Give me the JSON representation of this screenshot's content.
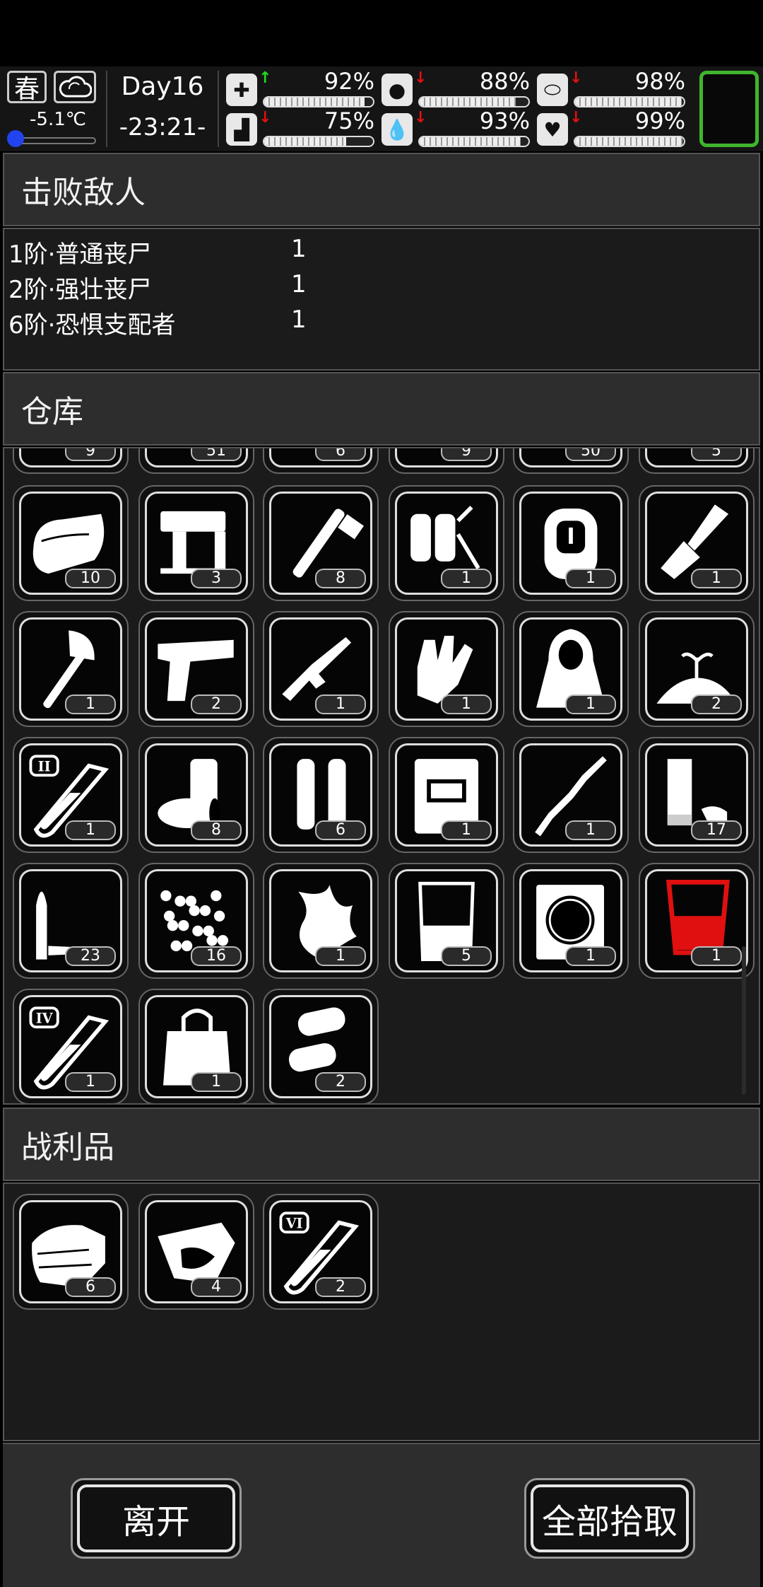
{
  "status": {
    "season": "春",
    "weather_icon": "cloud-icon",
    "temperature": "-5.1℃",
    "day": "Day16",
    "clock": "-23:21-",
    "stats": [
      {
        "key": "health",
        "icon": "medkit-icon",
        "trend": "up",
        "value": "92%",
        "level": 0.92
      },
      {
        "key": "hunger",
        "icon": "stomach-icon",
        "trend": "down",
        "value": "88%",
        "level": 0.88
      },
      {
        "key": "medicine",
        "icon": "pill-icon",
        "trend": "down",
        "value": "98%",
        "level": 0.98
      },
      {
        "key": "stamina",
        "icon": "boot-icon",
        "trend": "down",
        "value": "75%",
        "level": 0.75
      },
      {
        "key": "thirst",
        "icon": "water-drop-icon",
        "trend": "down",
        "value": "93%",
        "level": 0.93
      },
      {
        "key": "mood",
        "icon": "heart-icon",
        "trend": "down",
        "value": "99%",
        "level": 0.99
      }
    ]
  },
  "defeated": {
    "title": "击败敌人",
    "enemies": [
      {
        "name": "1阶·普通丧尸",
        "count": "1"
      },
      {
        "name": "2阶·强壮丧尸",
        "count": "1"
      },
      {
        "name": "6阶·恐惧支配者",
        "count": "1"
      }
    ]
  },
  "storage": {
    "title": "仓库",
    "partial_row": [
      "9",
      "51",
      "6",
      "9",
      "50",
      "5"
    ],
    "items": [
      {
        "icon": "cloth-icon",
        "count": "10"
      },
      {
        "icon": "nail-gun-icon",
        "count": "3"
      },
      {
        "icon": "pipe-wrench-icon",
        "count": "8"
      },
      {
        "icon": "scuba-tanks-icon",
        "count": "1"
      },
      {
        "icon": "backpack-icon",
        "count": "1"
      },
      {
        "icon": "shovel-icon",
        "count": "1"
      },
      {
        "icon": "axe-icon",
        "count": "1"
      },
      {
        "icon": "pistol-icon",
        "count": "2"
      },
      {
        "icon": "submachine-gun-icon",
        "count": "1"
      },
      {
        "icon": "glove-icon",
        "count": "1"
      },
      {
        "icon": "cloak-icon",
        "count": "1"
      },
      {
        "icon": "soil-sprout-icon",
        "count": "2"
      },
      {
        "icon": "test-tube-ii-icon",
        "count": "1",
        "label": "II"
      },
      {
        "icon": "cans-icon",
        "count": "8"
      },
      {
        "icon": "rifle-ammo-icon",
        "count": "6"
      },
      {
        "icon": "battery-blueprint-icon",
        "count": "1"
      },
      {
        "icon": "stick-icon",
        "count": "1"
      },
      {
        "icon": "shotgun-shell-icon",
        "count": "17"
      },
      {
        "icon": "bullet-icon",
        "count": "23"
      },
      {
        "icon": "seeds-icon",
        "count": "16"
      },
      {
        "icon": "herb-icon",
        "count": "1"
      },
      {
        "icon": "beaker-icon",
        "count": "5"
      },
      {
        "icon": "wheel-blueprint-icon",
        "count": "1"
      },
      {
        "icon": "red-liquid-glass-icon",
        "count": "1"
      },
      {
        "icon": "test-tube-iv-icon",
        "count": "1",
        "label": "IV"
      },
      {
        "icon": "bag-icon",
        "count": "1"
      },
      {
        "icon": "pistol-ammo-icon",
        "count": "2"
      }
    ]
  },
  "loot": {
    "title": "战利品",
    "items": [
      {
        "icon": "folded-cloth-icon",
        "count": "6"
      },
      {
        "icon": "meat-sack-icon",
        "count": "4"
      },
      {
        "icon": "test-tube-vi-icon",
        "count": "2",
        "label": "VI"
      }
    ]
  },
  "buttons": {
    "leave": "离开",
    "take_all": "全部拾取"
  },
  "colors": {
    "accent_green": "#3fb52d",
    "trend_up": "#1ee01e",
    "trend_down": "#e01010",
    "red_item": "#e01010"
  }
}
